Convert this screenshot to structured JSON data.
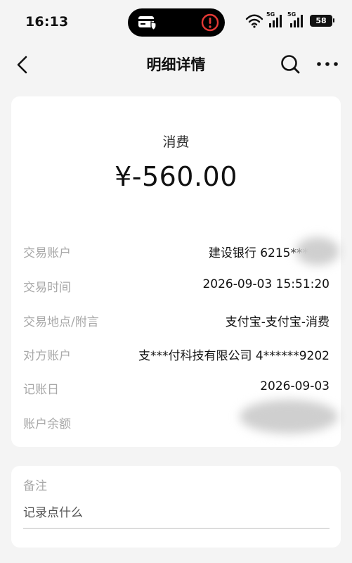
{
  "status_bar": {
    "time": "16:13",
    "network_tag_1": "5G",
    "network_tag_2": "5G",
    "battery": "58"
  },
  "nav": {
    "title": "明细详情",
    "back_icon": "chevron-left-icon",
    "search_icon": "search-icon",
    "more_icon": "more-horizontal-icon"
  },
  "transaction": {
    "type": "消费",
    "amount": "¥-560.00",
    "details": [
      {
        "label": "交易账户",
        "value": "建设银行 6215***"
      },
      {
        "label": "交易时间",
        "value": "2026-09-03 15:51:20"
      },
      {
        "label": "交易地点/附言",
        "value": "支付宝-支付宝-消费"
      },
      {
        "label": "对方账户",
        "value": "支***付科技有限公司 4******9202"
      },
      {
        "label": "记账日",
        "value": "2026-09-03"
      },
      {
        "label": "账户余额",
        "value": ""
      }
    ]
  },
  "notes": {
    "title": "备注",
    "placeholder": "记录点什么"
  },
  "colors": {
    "background": "#f4f4f4",
    "card": "#ffffff",
    "label_gray": "#a8a8a8",
    "text_primary": "#111111",
    "alert_red": "#e53935"
  }
}
